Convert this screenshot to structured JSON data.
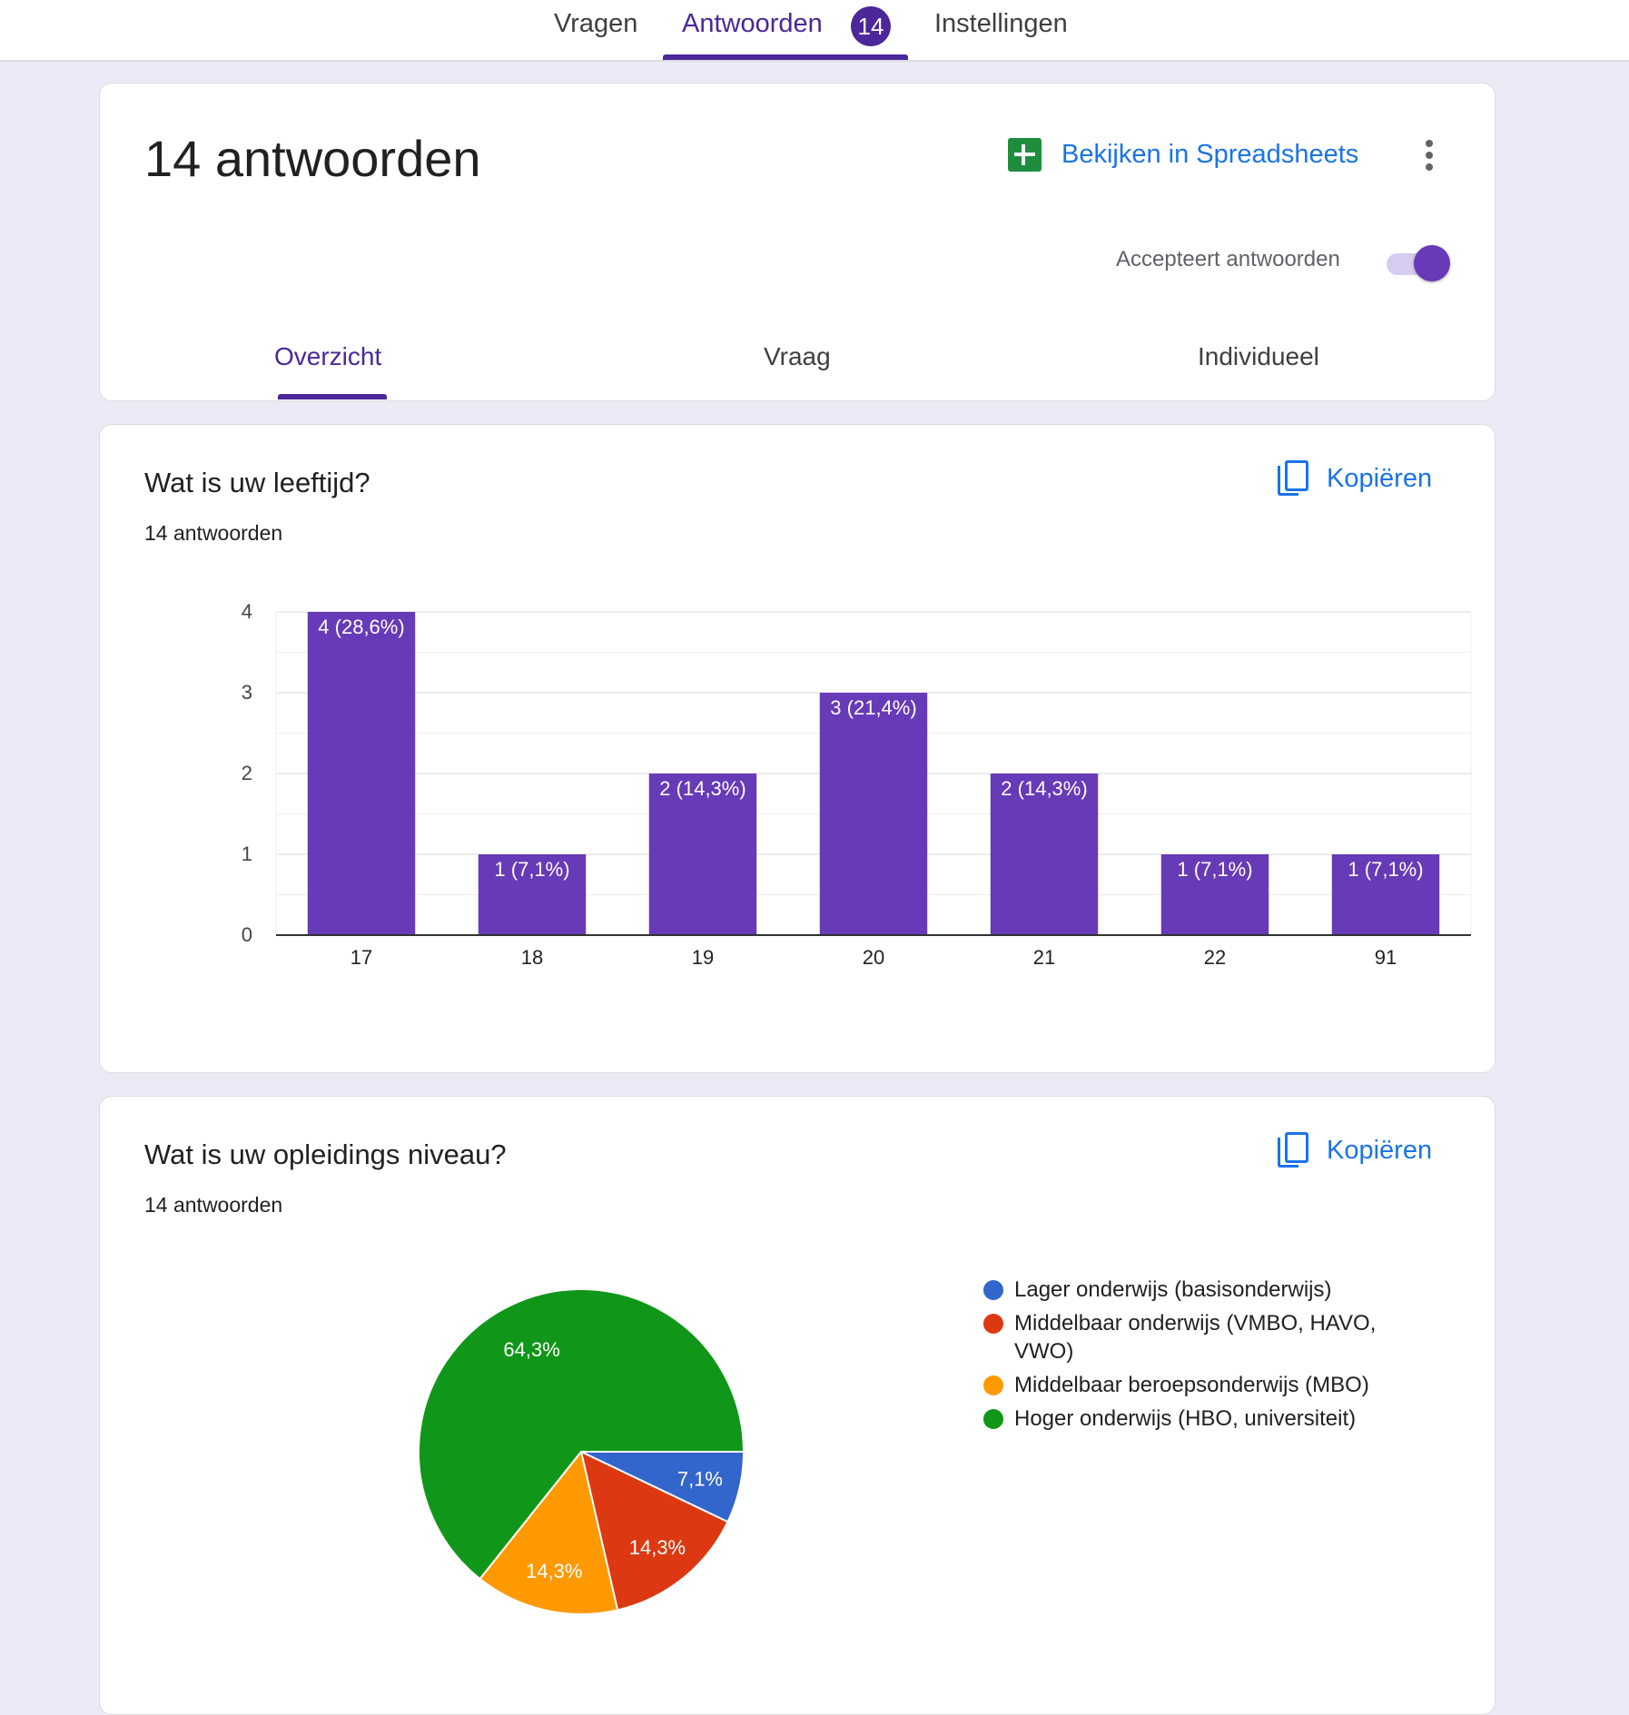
{
  "colors": {
    "accent": "#4b2799",
    "bar": "#673ab7",
    "link": "#1a73e8",
    "background": "#ede9f6"
  },
  "topnav": {
    "tabs": [
      {
        "label": "Vragen"
      },
      {
        "label": "Antwoorden",
        "badge": "14",
        "active": true
      },
      {
        "label": "Instellingen"
      }
    ]
  },
  "summary": {
    "title": "14 antwoorden",
    "sheets_label": "Bekijken in Spreadsheets",
    "sheets_icon": "sheets-icon",
    "more_icon": "more-vert-icon",
    "accepting_label": "Accepteert antwoorden",
    "accepting": true,
    "tabs": [
      {
        "label": "Overzicht",
        "active": true
      },
      {
        "label": "Vraag"
      },
      {
        "label": "Individueel"
      }
    ]
  },
  "questions": [
    {
      "title": "Wat is uw leeftijd?",
      "count": "14 antwoorden",
      "copy_label": "Kopiëren",
      "copy_icon": "copy-icon"
    },
    {
      "title": "Wat is uw opleidings niveau?",
      "count": "14 antwoorden",
      "copy_label": "Kopiëren",
      "copy_icon": "copy-icon"
    }
  ],
  "chart_data": [
    {
      "type": "bar",
      "categories": [
        "17",
        "18",
        "19",
        "20",
        "21",
        "22",
        "91"
      ],
      "values": [
        4,
        1,
        2,
        3,
        2,
        1,
        1
      ],
      "labels": [
        "4 (28,6%)",
        "1 (7,1%)",
        "2 (14,3%)",
        "3 (21,4%)",
        "2 (14,3%)",
        "1 (7,1%)",
        "1 (7,1%)"
      ],
      "ylim": [
        0,
        4
      ],
      "yticks": [
        "0",
        "1",
        "2",
        "3",
        "4"
      ],
      "grid": true,
      "color": "#673ab7"
    },
    {
      "type": "pie",
      "labels": [
        "Lager onderwijs (basisonderwijs)",
        "Middelbaar onderwijs (VMBO, HAVO, VWO)",
        "Middelbaar beroepsonderwijs (MBO)",
        "Hoger onderwijs (HBO, universiteit)"
      ],
      "values": [
        7.1,
        14.3,
        14.3,
        64.3
      ],
      "value_labels": [
        "7,1%",
        "14,3%",
        "14,3%",
        "64,3%"
      ],
      "colors": [
        "#3366cc",
        "#dc3912",
        "#ff9900",
        "#109618"
      ],
      "legend_position": "right"
    }
  ]
}
